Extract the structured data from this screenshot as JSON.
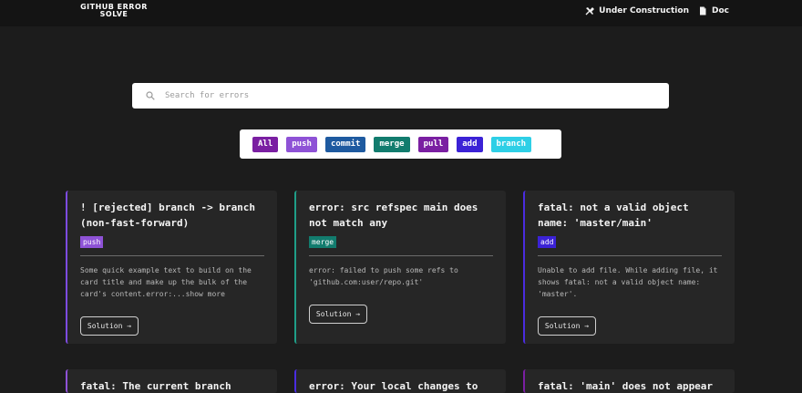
{
  "header": {
    "logo_line1": "GITHUB ERROR",
    "logo_line2": "SOLVE",
    "nav": [
      {
        "label": "Under Construction",
        "icon": "tools-icon"
      },
      {
        "label": "Doc",
        "icon": "document-icon"
      }
    ]
  },
  "search": {
    "placeholder": "Search for errors",
    "value": ""
  },
  "filters": [
    {
      "label": "All",
      "color": "#7a1fa2"
    },
    {
      "label": "push",
      "color": "#8e52d6"
    },
    {
      "label": "commit",
      "color": "#1e5aa0"
    },
    {
      "label": "merge",
      "color": "#127c6e"
    },
    {
      "label": "pull",
      "color": "#7a1fa2"
    },
    {
      "label": "add",
      "color": "#3b22d6"
    },
    {
      "label": "branch",
      "color": "#2ecfe6"
    }
  ],
  "cards": [
    {
      "title": "! [rejected] branch -> branch (non-fast-forward)",
      "tag": "push",
      "tag_color": "#8e52d6",
      "body": "Some quick example text to build on the card title and make up the bulk of the card's content.error:...show more",
      "button": "Solution →",
      "accent": "#7d4be0"
    },
    {
      "title": "error: src refspec main does not match any",
      "tag": "merge",
      "tag_color": "#127c6e",
      "body": "error: failed to push some refs to 'github.com:user/repo.git'",
      "button": "Solution →",
      "accent": "#1f9e88"
    },
    {
      "title": "fatal: not a valid object name: 'master/main'",
      "tag": "add",
      "tag_color": "#3b22d6",
      "body": "Unable to add file. While adding file, it shows fatal: not a valid object name: 'master'.",
      "button": "Solution →",
      "accent": "#4a2ce0"
    },
    {
      "title": "fatal: The current branch master",
      "accent": "#8e52d6"
    },
    {
      "title": "error: Your local changes to the",
      "accent": "#4a2ce0"
    },
    {
      "title": "fatal: 'main' does not appear to",
      "accent": "#7a1fa2"
    }
  ]
}
